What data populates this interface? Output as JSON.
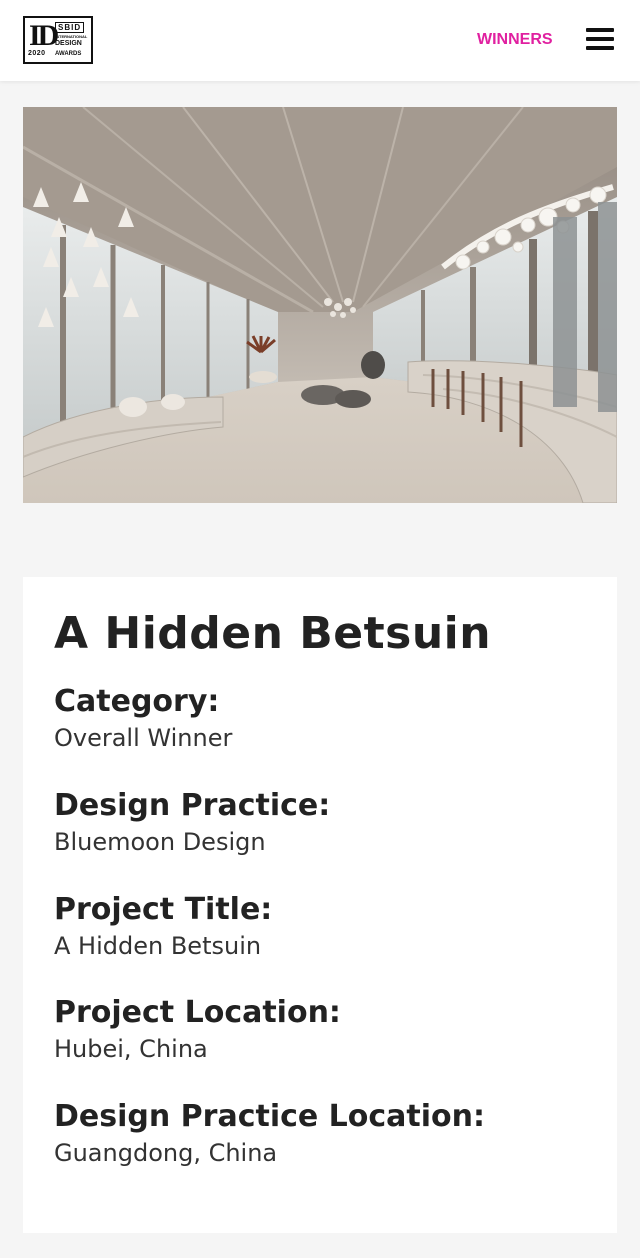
{
  "header": {
    "logo": {
      "mark": "ID",
      "sbid": "SBID",
      "international": "INTERNATIONAL",
      "design": "DESIGN",
      "year": "2020",
      "awards": "AWARDS"
    },
    "nav_winners_label": "WINNERS",
    "menu_icon": "hamburger-menu-icon"
  },
  "colors": {
    "accent": "#e020a0",
    "page_background": "#f5f5f5",
    "card_background": "#ffffff",
    "text": "#222222"
  },
  "hero": {
    "icon": "interior-photo"
  },
  "project": {
    "title": "A Hidden Betsuin",
    "fields": [
      {
        "label": "Category:",
        "value": "Overall Winner"
      },
      {
        "label": "Design Practice:",
        "value": "Bluemoon Design"
      },
      {
        "label": "Project Title:",
        "value": "A Hidden Betsuin"
      },
      {
        "label": "Project Location:",
        "value": "Hubei, China"
      },
      {
        "label": "Design Practice Location:",
        "value": "Guangdong, China"
      }
    ]
  }
}
